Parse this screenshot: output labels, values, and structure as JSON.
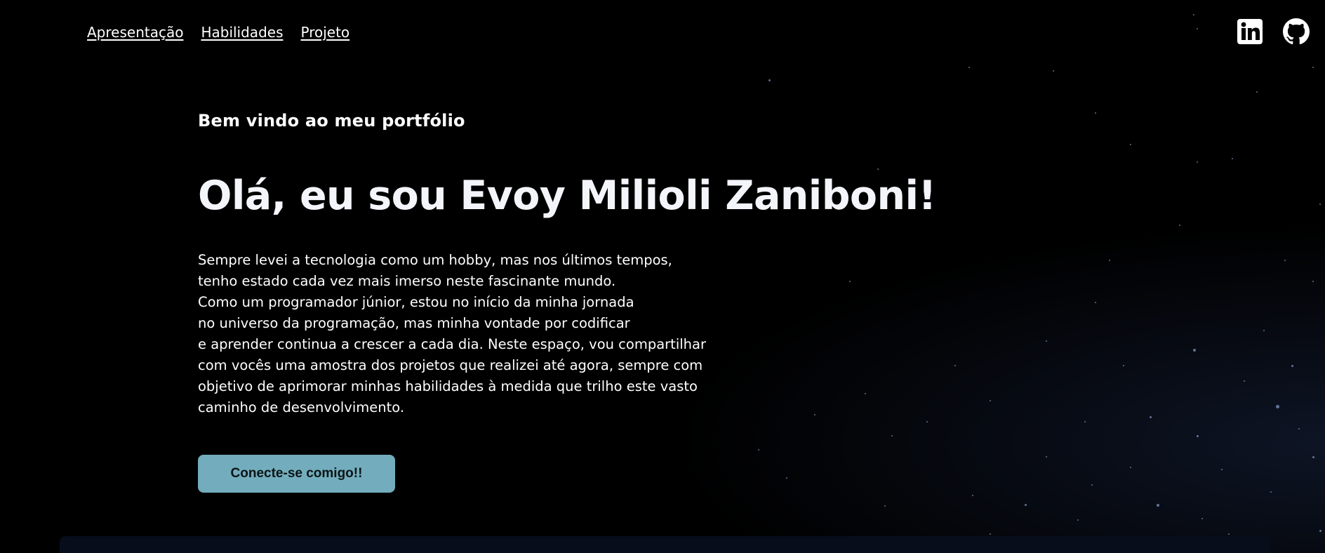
{
  "nav": {
    "items": [
      {
        "label": "Apresentação"
      },
      {
        "label": "Habilidades"
      },
      {
        "label": "Projeto"
      }
    ]
  },
  "social": {
    "links": [
      {
        "icon": "linkedin-icon"
      },
      {
        "icon": "github-icon"
      }
    ]
  },
  "hero": {
    "welcome": "Bem vindo ao meu portfólio",
    "headline": "Olá, eu sou Evoy Milioli Zaniboni!",
    "bio_lines": [
      "Sempre levei a tecnologia como um hobby, mas nos últimos tempos,",
      "tenho estado cada vez mais imerso neste fascinante mundo.",
      "Como um programador júnior, estou no início da minha jornada",
      "no universo da programação, mas minha vontade por codificar",
      "e aprender continua a crescer a cada dia. Neste espaço, vou compartilhar",
      "com vocês uma amostra dos projetos que realizei até agora, sempre com",
      "objetivo de aprimorar minhas habilidades à medida que trilho este vasto",
      "caminho de desenvolvimento."
    ],
    "cta_label": "Conecte-se comigo!!"
  },
  "colors": {
    "background": "#000000",
    "cta_background": "#73adbd",
    "panel": "#070d1b",
    "text": "#ffffff"
  }
}
